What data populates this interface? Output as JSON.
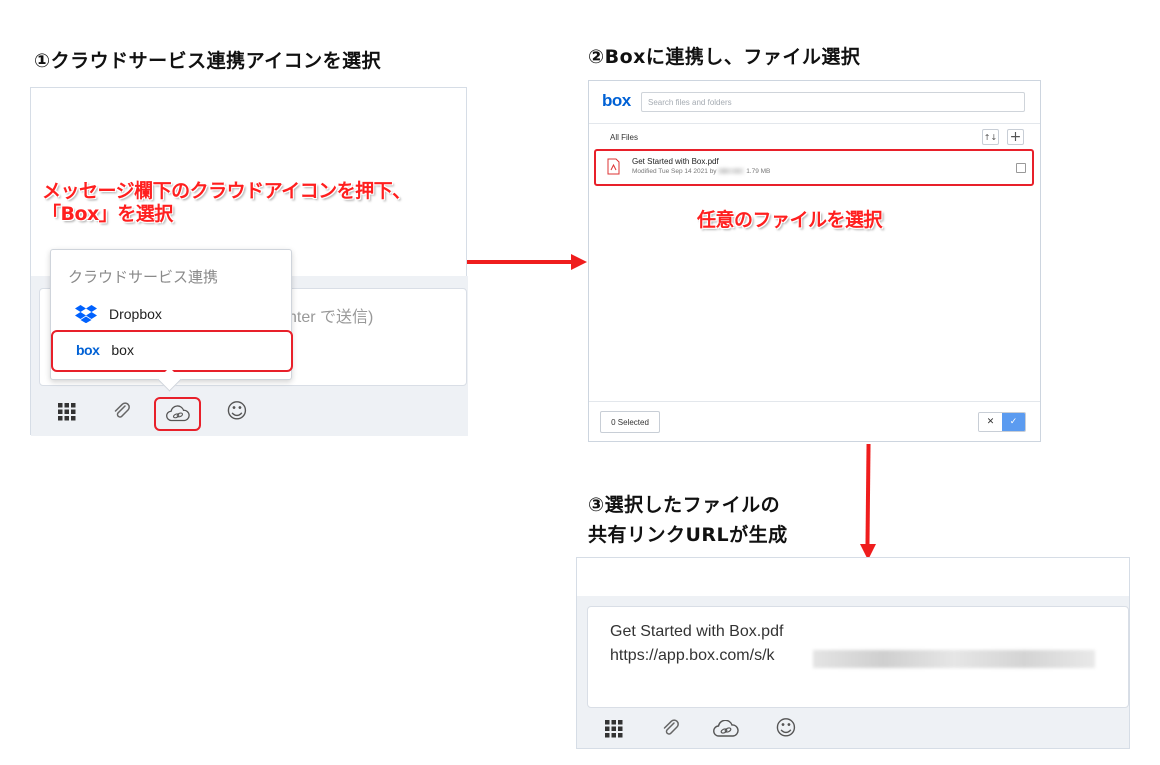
{
  "steps": {
    "step1_title": "①クラウドサービス連携アイコンを選択",
    "step2_title": "②Boxに連携し、ファイル選択",
    "step3_title_line1": "③選択したファイルの",
    "step3_title_line2": "共有リンクURLが生成"
  },
  "panel1": {
    "annotation_line1": "メッセージ欄下のクラウドアイコンを押下、",
    "annotation_line2": "「Box」を選択",
    "input_placeholder_fragment": "nter で送信)",
    "dropdown": {
      "header": "クラウドサービス連携",
      "items": [
        {
          "label": "Dropbox",
          "icon": "dropbox-icon"
        },
        {
          "label": "box",
          "icon": "box-logo-icon",
          "logo_text": "box"
        }
      ]
    },
    "toolbar_icons": [
      "grid-icon",
      "paperclip-icon",
      "cloud-link-icon",
      "emoji-icon"
    ],
    "emoji_glyph": "☺"
  },
  "panel2": {
    "logo": "box",
    "search_placeholder": "Search files and folders",
    "breadcrumb": "All Files",
    "sort_glyph": "↑↓",
    "add_glyph": "+",
    "file": {
      "name": "Get Started with Box.pdf",
      "meta_prefix": "Modified Tue Sep 14 2021 by",
      "size": "1.79 MB"
    },
    "annotation": "任意のファイルを選択",
    "selected_label": "0 Selected",
    "cancel_glyph": "✕",
    "confirm_glyph": "✓"
  },
  "panel3": {
    "line1": "Get Started with Box.pdf",
    "line2": "https://app.box.com/s/k"
  },
  "colors": {
    "accent_red": "#e8202a",
    "box_blue": "#0061d5",
    "dropbox_blue": "#0061fe",
    "confirm_blue": "#5b9bf0"
  }
}
